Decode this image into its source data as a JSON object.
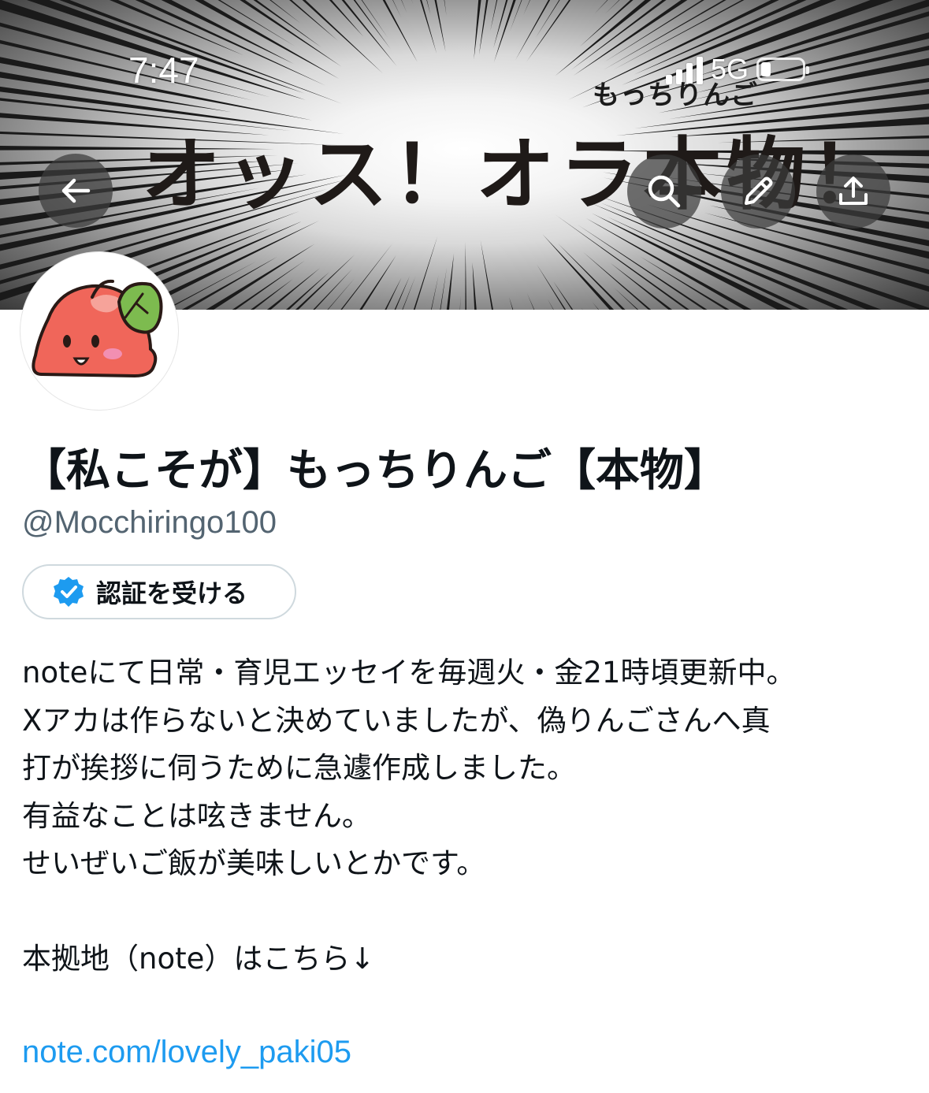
{
  "status_bar": {
    "time": "7:47",
    "network": "5G"
  },
  "banner": {
    "subtitle": "もっちりんご",
    "title": "オッス！オラ本物！"
  },
  "header_buttons": {
    "back": "arrow-left-icon",
    "search": "search-icon",
    "edit": "pencil-icon",
    "share": "share-icon"
  },
  "profile": {
    "display_name": "【私こそが】もっちりんご【本物】",
    "handle": "@Mocchiringo100",
    "verify_label": "認証を受ける",
    "bio_lines": [
      "noteにて日常・育児エッセイを毎週火・金21時頃更新中。",
      "Xアカは作らないと決めていましたが、偽りんごさんへ真",
      "打が挨拶に伺うために急遽作成しました。",
      "有益なことは呟きません。",
      "せいぜいご飯が美味しいとかです。",
      "",
      "本拠地（note）はこちら↓",
      ""
    ],
    "link": "note.com/lovely_paki05"
  },
  "colors": {
    "link": "#1d9bf0",
    "verify_badge": "#1d9bf0",
    "handle": "#536471"
  }
}
